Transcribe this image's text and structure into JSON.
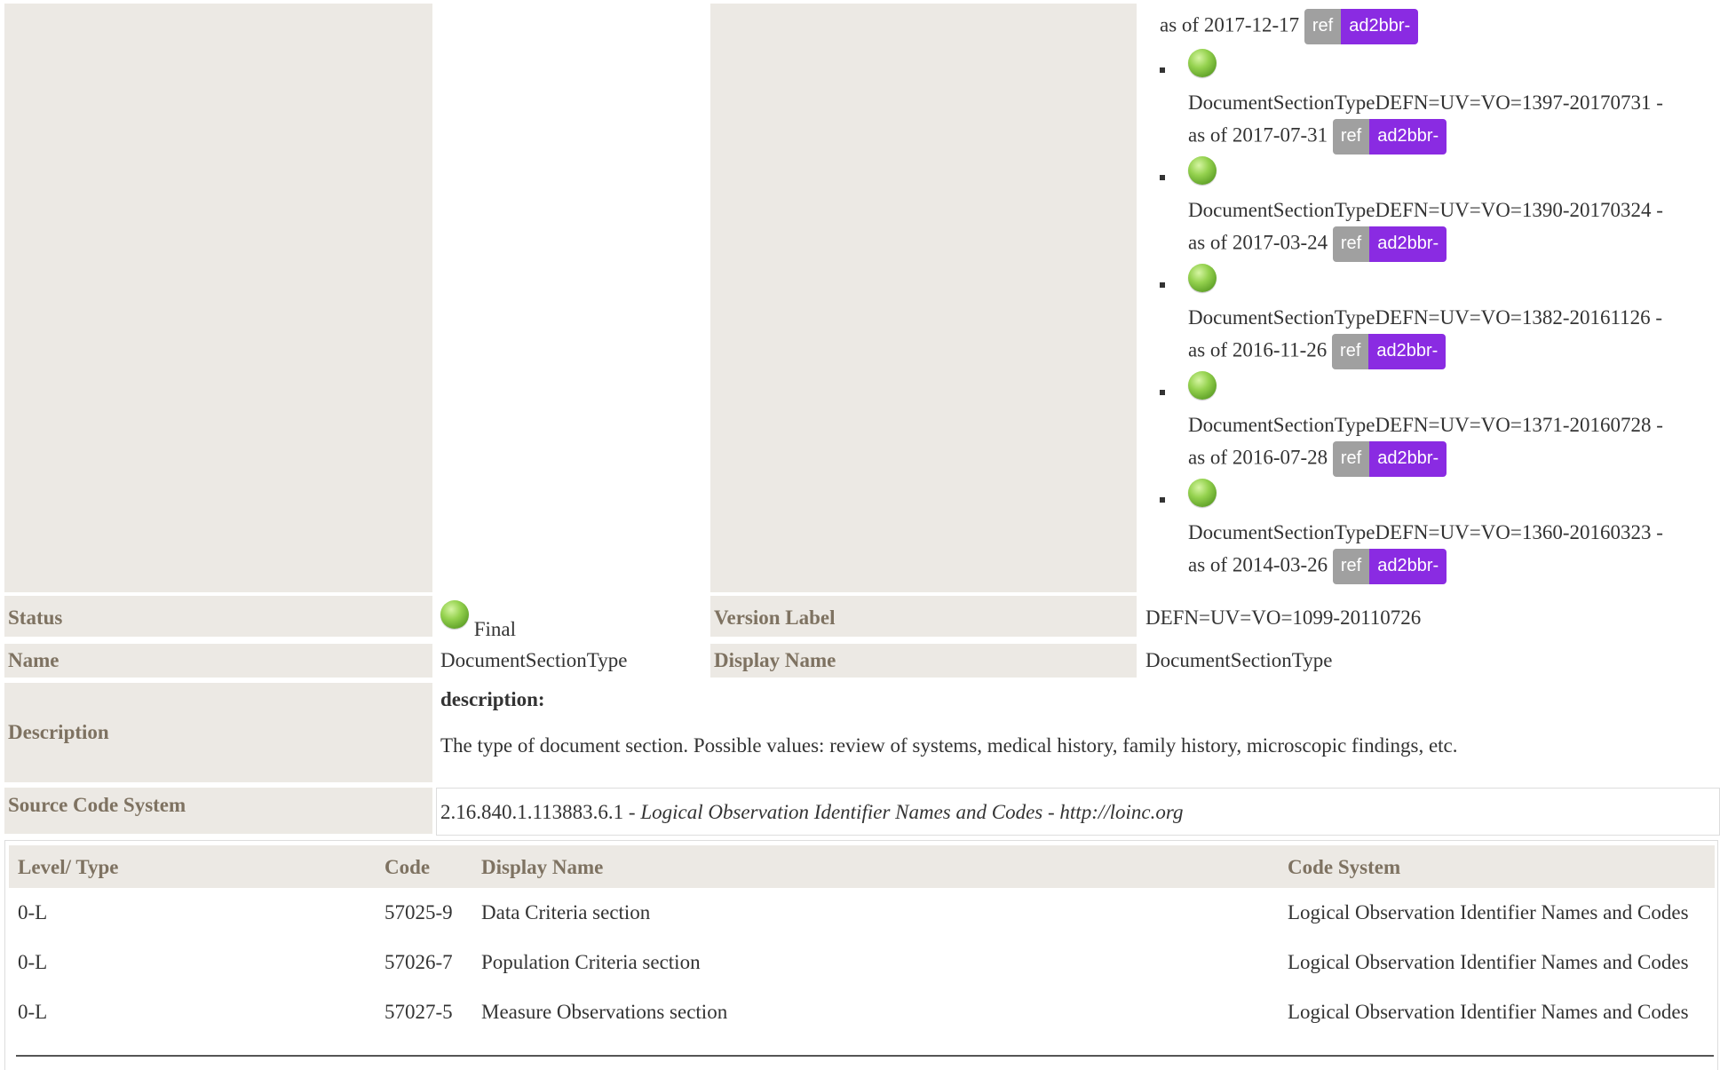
{
  "colors": {
    "label_bg": "#ECE9E4",
    "label_text": "#7E7261",
    "ref_badge": "#a0a0a0",
    "ver_badge": "#8a2be2",
    "status_dot": "#7ec13e"
  },
  "versions": {
    "top_fragment": "as of 2017-12-17",
    "items": [
      {
        "id": "DocumentSectionTypeDEFN=UV=VO=1397-20170731 -",
        "date": "as of 2017-07-31"
      },
      {
        "id": "DocumentSectionTypeDEFN=UV=VO=1390-20170324 -",
        "date": "as of 2017-03-24"
      },
      {
        "id": "DocumentSectionTypeDEFN=UV=VO=1382-20161126 -",
        "date": "as of 2016-11-26"
      },
      {
        "id": "DocumentSectionTypeDEFN=UV=VO=1371-20160728 -",
        "date": "as of 2016-07-28"
      },
      {
        "id": "DocumentSectionTypeDEFN=UV=VO=1360-20160323 -",
        "date": "as of 2014-03-26"
      }
    ],
    "ref_label": "ref",
    "ver_label": "ad2bbr-"
  },
  "status": {
    "label": "Status",
    "value": "Final"
  },
  "version_label": {
    "label": "Version Label",
    "value": "DEFN=UV=VO=1099-20110726"
  },
  "name": {
    "label": "Name",
    "value": "DocumentSectionType"
  },
  "display_name": {
    "label": "Display Name",
    "value": "DocumentSectionType"
  },
  "description": {
    "label": "Description",
    "heading": "description:",
    "text": "The type of document section. Possible values: review of systems, medical history, family history, microscopic findings, etc."
  },
  "source_code_system": {
    "label": "Source Code System",
    "oid": "2.16.840.1.113883.6.1 - ",
    "name": "Logical Observation Identifier Names and Codes",
    "sep": " - ",
    "url": "http://loinc.org"
  },
  "codes_table": {
    "headers": [
      "Level/ Type",
      "Code",
      "Display Name",
      "Code System"
    ],
    "rows": [
      [
        "0-L",
        "57025-9",
        "Data Criteria section",
        "Logical Observation Identifier Names and Codes"
      ],
      [
        "0-L",
        "57026-7",
        "Population Criteria section",
        "Logical Observation Identifier Names and Codes"
      ],
      [
        "0-L",
        "57027-5",
        "Measure Observations section",
        "Logical Observation Identifier Names and Codes"
      ]
    ]
  }
}
